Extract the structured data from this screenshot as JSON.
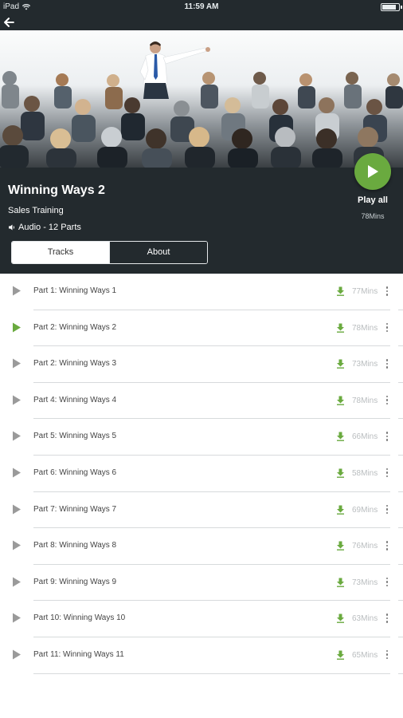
{
  "status_bar": {
    "device": "iPad",
    "time": "11:59 AM"
  },
  "nav": {
    "back_icon": "back-arrow-icon"
  },
  "course": {
    "title": "Winning Ways 2",
    "subtitle": "Sales Training",
    "meta": "Audio - 12 Parts",
    "play_all_label": "Play all",
    "play_all_duration": "78Mins"
  },
  "tabs": [
    {
      "label": "Tracks",
      "active": true
    },
    {
      "label": "About",
      "active": false
    }
  ],
  "colors": {
    "accent": "#6aaa3f",
    "header_bg": "#232a2e",
    "inactive_play": "#9a9a9a"
  },
  "tracks": [
    {
      "title": "Part 1: Winning Ways 1",
      "duration": "77Mins",
      "playing": false
    },
    {
      "title": "Part 2: Winning Ways 2",
      "duration": "78Mins",
      "playing": true
    },
    {
      "title": "Part 2: Winning Ways 3",
      "duration": "73Mins",
      "playing": false
    },
    {
      "title": "Part 4: Winning Ways 4",
      "duration": "78Mins",
      "playing": false
    },
    {
      "title": "Part 5: Winning Ways 5",
      "duration": "66Mins",
      "playing": false
    },
    {
      "title": "Part 6: Winning Ways 6",
      "duration": "58Mins",
      "playing": false
    },
    {
      "title": "Part 7: Winning Ways 7",
      "duration": "69Mins",
      "playing": false
    },
    {
      "title": "Part 8: Winning Ways 8",
      "duration": "76Mins",
      "playing": false
    },
    {
      "title": "Part 9: Winning Ways 9",
      "duration": "73Mins",
      "playing": false
    },
    {
      "title": "Part 10: Winning Ways 10",
      "duration": "63Mins",
      "playing": false
    },
    {
      "title": "Part 11: Winning Ways 11",
      "duration": "65Mins",
      "playing": false
    }
  ]
}
